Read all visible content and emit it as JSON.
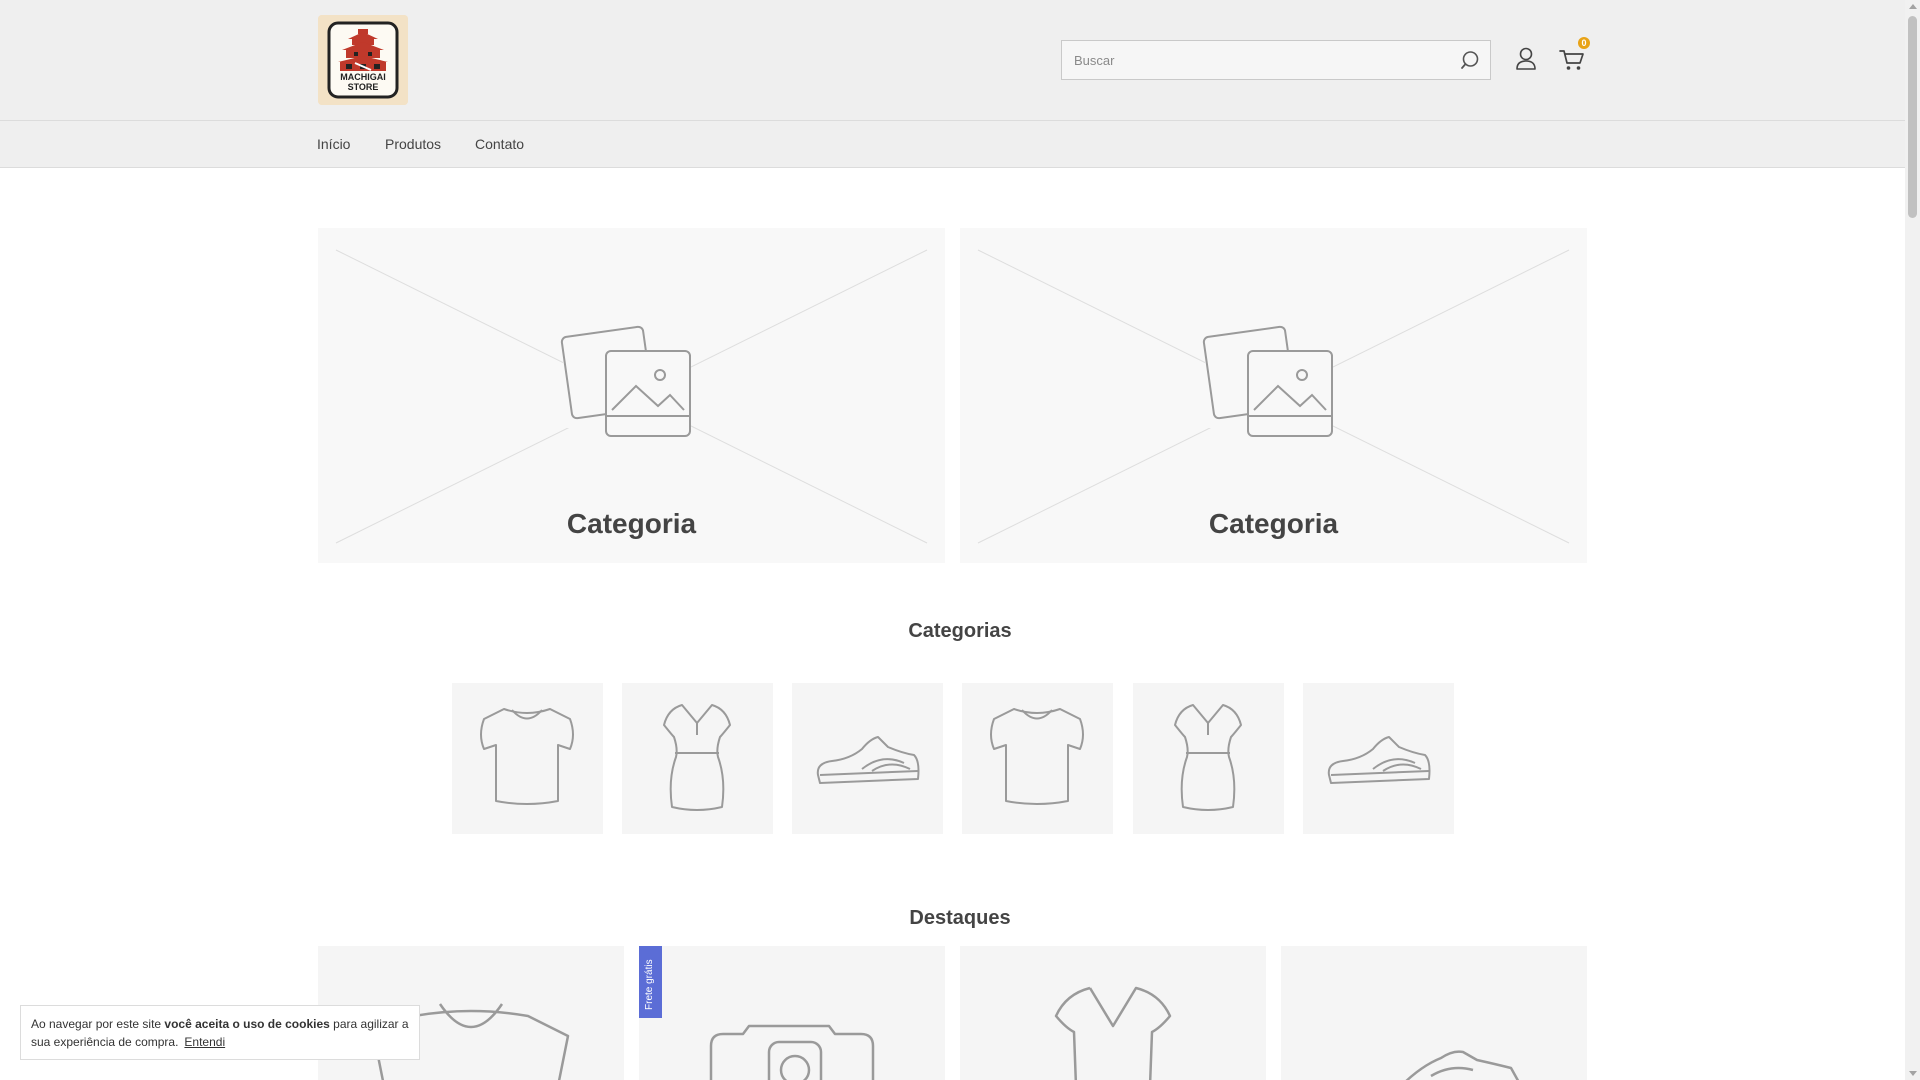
{
  "header": {
    "logo_alt": "MACHIGAI STORE",
    "logo_line1": "MACHIGAI",
    "logo_line2": "STORE",
    "search": {
      "placeholder": "Buscar",
      "value": ""
    },
    "icons": {
      "search": "search-icon",
      "account": "user-icon",
      "cart": "cart-icon"
    },
    "cart_count": "0"
  },
  "nav": {
    "items": [
      {
        "label": "Início"
      },
      {
        "label": "Produtos"
      },
      {
        "label": "Contato"
      }
    ]
  },
  "banners": [
    {
      "title": "Categoria",
      "icon": "image-placeholder-icon"
    },
    {
      "title": "Categoria",
      "icon": "image-placeholder-icon"
    }
  ],
  "categories": {
    "title": "Categorias",
    "items": [
      {
        "icon": "tshirt-icon"
      },
      {
        "icon": "dress-icon"
      },
      {
        "icon": "sneaker-icon"
      },
      {
        "icon": "tshirt-icon"
      },
      {
        "icon": "dress-icon"
      },
      {
        "icon": "sneaker-icon"
      }
    ]
  },
  "featured": {
    "title": "Destaques",
    "products": [
      {
        "icon": "tshirt-icon",
        "tag": ""
      },
      {
        "icon": "camera-icon",
        "tag": "Frete grátis"
      },
      {
        "icon": "dress-icon",
        "tag": ""
      },
      {
        "icon": "sneaker-icon",
        "tag": ""
      }
    ]
  },
  "cookie_banner": {
    "text_before": "Ao navegar por este site ",
    "text_bold": "você aceita o uso de cookies",
    "text_after": " para agilizar a sua experiência de compra.",
    "accept_label": "Entendi"
  },
  "colors": {
    "header_bg": "#efefef",
    "badge": "#e8a317",
    "free_shipping_tag": "#5b6dd6",
    "logo_red": "#c0392b"
  }
}
